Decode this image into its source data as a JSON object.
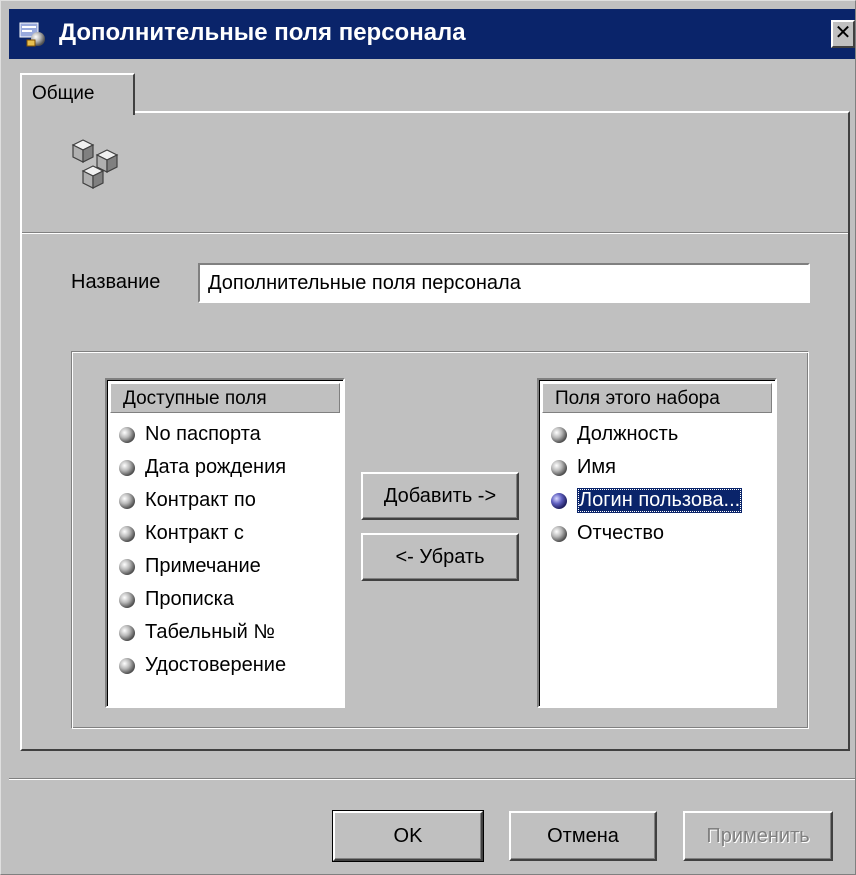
{
  "window": {
    "title": "Дополнительные поля персонала",
    "close_label": "✕"
  },
  "tabs": [
    {
      "label": "Общие",
      "selected": true
    }
  ],
  "form": {
    "name_label": "Название",
    "name_value": "Дополнительные поля персонала"
  },
  "available_fields": {
    "header": "Доступные поля",
    "items": [
      "No паспорта",
      "Дата рождения",
      "Контракт по",
      "Контракт с",
      "Примечание",
      "Прописка",
      "Табельный №",
      "Удостоверение"
    ]
  },
  "set_fields": {
    "header": "Поля этого набора",
    "items": [
      "Должность",
      "Имя",
      "Логин пользова...",
      "Отчество"
    ],
    "selected_index": 2
  },
  "transfer_buttons": {
    "add": "Добавить ->",
    "remove": "<- Убрать"
  },
  "footer_buttons": {
    "ok": "OK",
    "cancel": "Отмена",
    "apply": "Применить",
    "apply_disabled": true
  },
  "colors": {
    "selection": "#0a246a",
    "face": "#c0c0c0"
  },
  "icons": {
    "title": "dialog-icon",
    "header": "cubes-icon",
    "field": "sphere-icon"
  }
}
